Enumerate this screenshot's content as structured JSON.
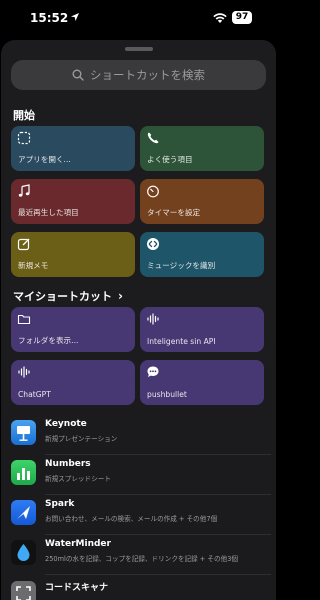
{
  "status": {
    "time": "15:52",
    "battery": "97"
  },
  "search": {
    "placeholder": "ショートカットを検索"
  },
  "sections": {
    "start": "開始",
    "my_shortcuts": "マイショートカット"
  },
  "start_tiles": [
    {
      "label": "アプリを開く...",
      "icon": "app-open-icon",
      "color": "#2a4a5f"
    },
    {
      "label": "よく使う項目",
      "icon": "phone-icon",
      "color": "#2d5438"
    },
    {
      "label": "最近再生した項目",
      "icon": "music-note-icon",
      "color": "#6a2a2d"
    },
    {
      "label": "タイマーを設定",
      "icon": "timer-icon",
      "color": "#74411f"
    },
    {
      "label": "新規メモ",
      "icon": "compose-icon",
      "color": "#6b5f18"
    },
    {
      "label": "ミュージックを識別",
      "icon": "shazam-icon",
      "color": "#1f5568"
    }
  ],
  "my_tiles": [
    {
      "label": "フォルダを表示...",
      "icon": "folder-icon"
    },
    {
      "label": "Inteligente sin API",
      "icon": "waveform-icon"
    },
    {
      "label": "ChatGPT",
      "icon": "waveform-icon"
    },
    {
      "label": "pushbullet",
      "icon": "message-icon"
    }
  ],
  "apps": [
    {
      "name": "Keynote",
      "desc": "新規プレゼンテーション",
      "icon": "keynote-icon"
    },
    {
      "name": "Numbers",
      "desc": "新規スプレッドシート",
      "icon": "numbers-icon"
    },
    {
      "name": "Spark",
      "desc": "お問い合わせ、メールの検索、メールの作成 + その他7個",
      "icon": "spark-icon"
    },
    {
      "name": "WaterMinder",
      "desc": "250mlの水を記録、コップを記録、ドリンクを記録 + その他3個",
      "icon": "waterminder-icon"
    },
    {
      "name": "コードスキャナ",
      "desc": "",
      "icon": "code-scanner-icon"
    }
  ]
}
